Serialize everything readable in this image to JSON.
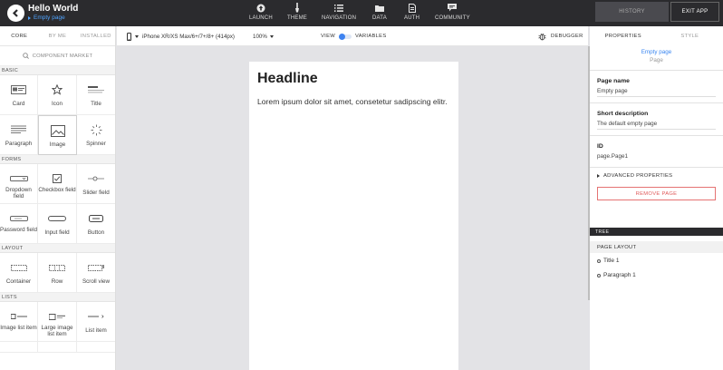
{
  "app": {
    "title": "Hello World",
    "page": "Empty page"
  },
  "nav": [
    {
      "label": "LAUNCH",
      "icon": "rocket-icon"
    },
    {
      "label": "THEME",
      "icon": "brush-icon"
    },
    {
      "label": "NAVIGATION",
      "icon": "list-icon"
    },
    {
      "label": "DATA",
      "icon": "folder-icon"
    },
    {
      "label": "AUTH",
      "icon": "document-icon"
    },
    {
      "label": "COMMUNITY",
      "icon": "chat-icon"
    }
  ],
  "header_buttons": {
    "history": "HISTORY",
    "exit": "EXIT APP"
  },
  "left_tabs": [
    "CORE",
    "BY ME",
    "INSTALLED"
  ],
  "component_market": "COMPONENT MARKET",
  "sections": {
    "basic": {
      "title": "BASIC",
      "items": [
        "Card",
        "Icon",
        "Title",
        "Paragraph",
        "Image",
        "Spinner"
      ]
    },
    "forms": {
      "title": "FORMS",
      "items": [
        "Dropdown field",
        "Checkbox field",
        "Slider field",
        "Password field",
        "Input field",
        "Button"
      ]
    },
    "layout": {
      "title": "LAYOUT",
      "items": [
        "Container",
        "Row",
        "Scroll view"
      ]
    },
    "lists": {
      "title": "LISTS",
      "items": [
        "Image list item",
        "Large image list item",
        "List item"
      ]
    }
  },
  "toolbar": {
    "device": "iPhone XR/XS Max/6+/7+/8+ (414px)",
    "zoom": "100%",
    "view": "VIEW",
    "variables": "VARIABLES",
    "debugger": "DEBUGGER"
  },
  "canvas": {
    "headline": "Headline",
    "paragraph": "Lorem ipsum dolor sit amet, consetetur sadipscing elitr."
  },
  "right_tabs": [
    "PROPERTIES",
    "STYLE"
  ],
  "properties": {
    "selected_name": "Empty page",
    "selected_type": "Page",
    "page_name_label": "Page name",
    "page_name_value": "Empty page",
    "short_desc_label": "Short description",
    "short_desc_value": "The default empty page",
    "id_label": "ID",
    "id_value": "page.Page1",
    "advanced": "ADVANCED PROPERTIES",
    "remove": "REMOVE PAGE"
  },
  "tree": {
    "title": "TREE",
    "layout_title": "PAGE LAYOUT",
    "items": [
      "Title 1",
      "Paragraph 1"
    ]
  },
  "colors": {
    "accent": "#3d82f0",
    "topbar": "#2b2b2e",
    "danger": "#e05b5b"
  }
}
